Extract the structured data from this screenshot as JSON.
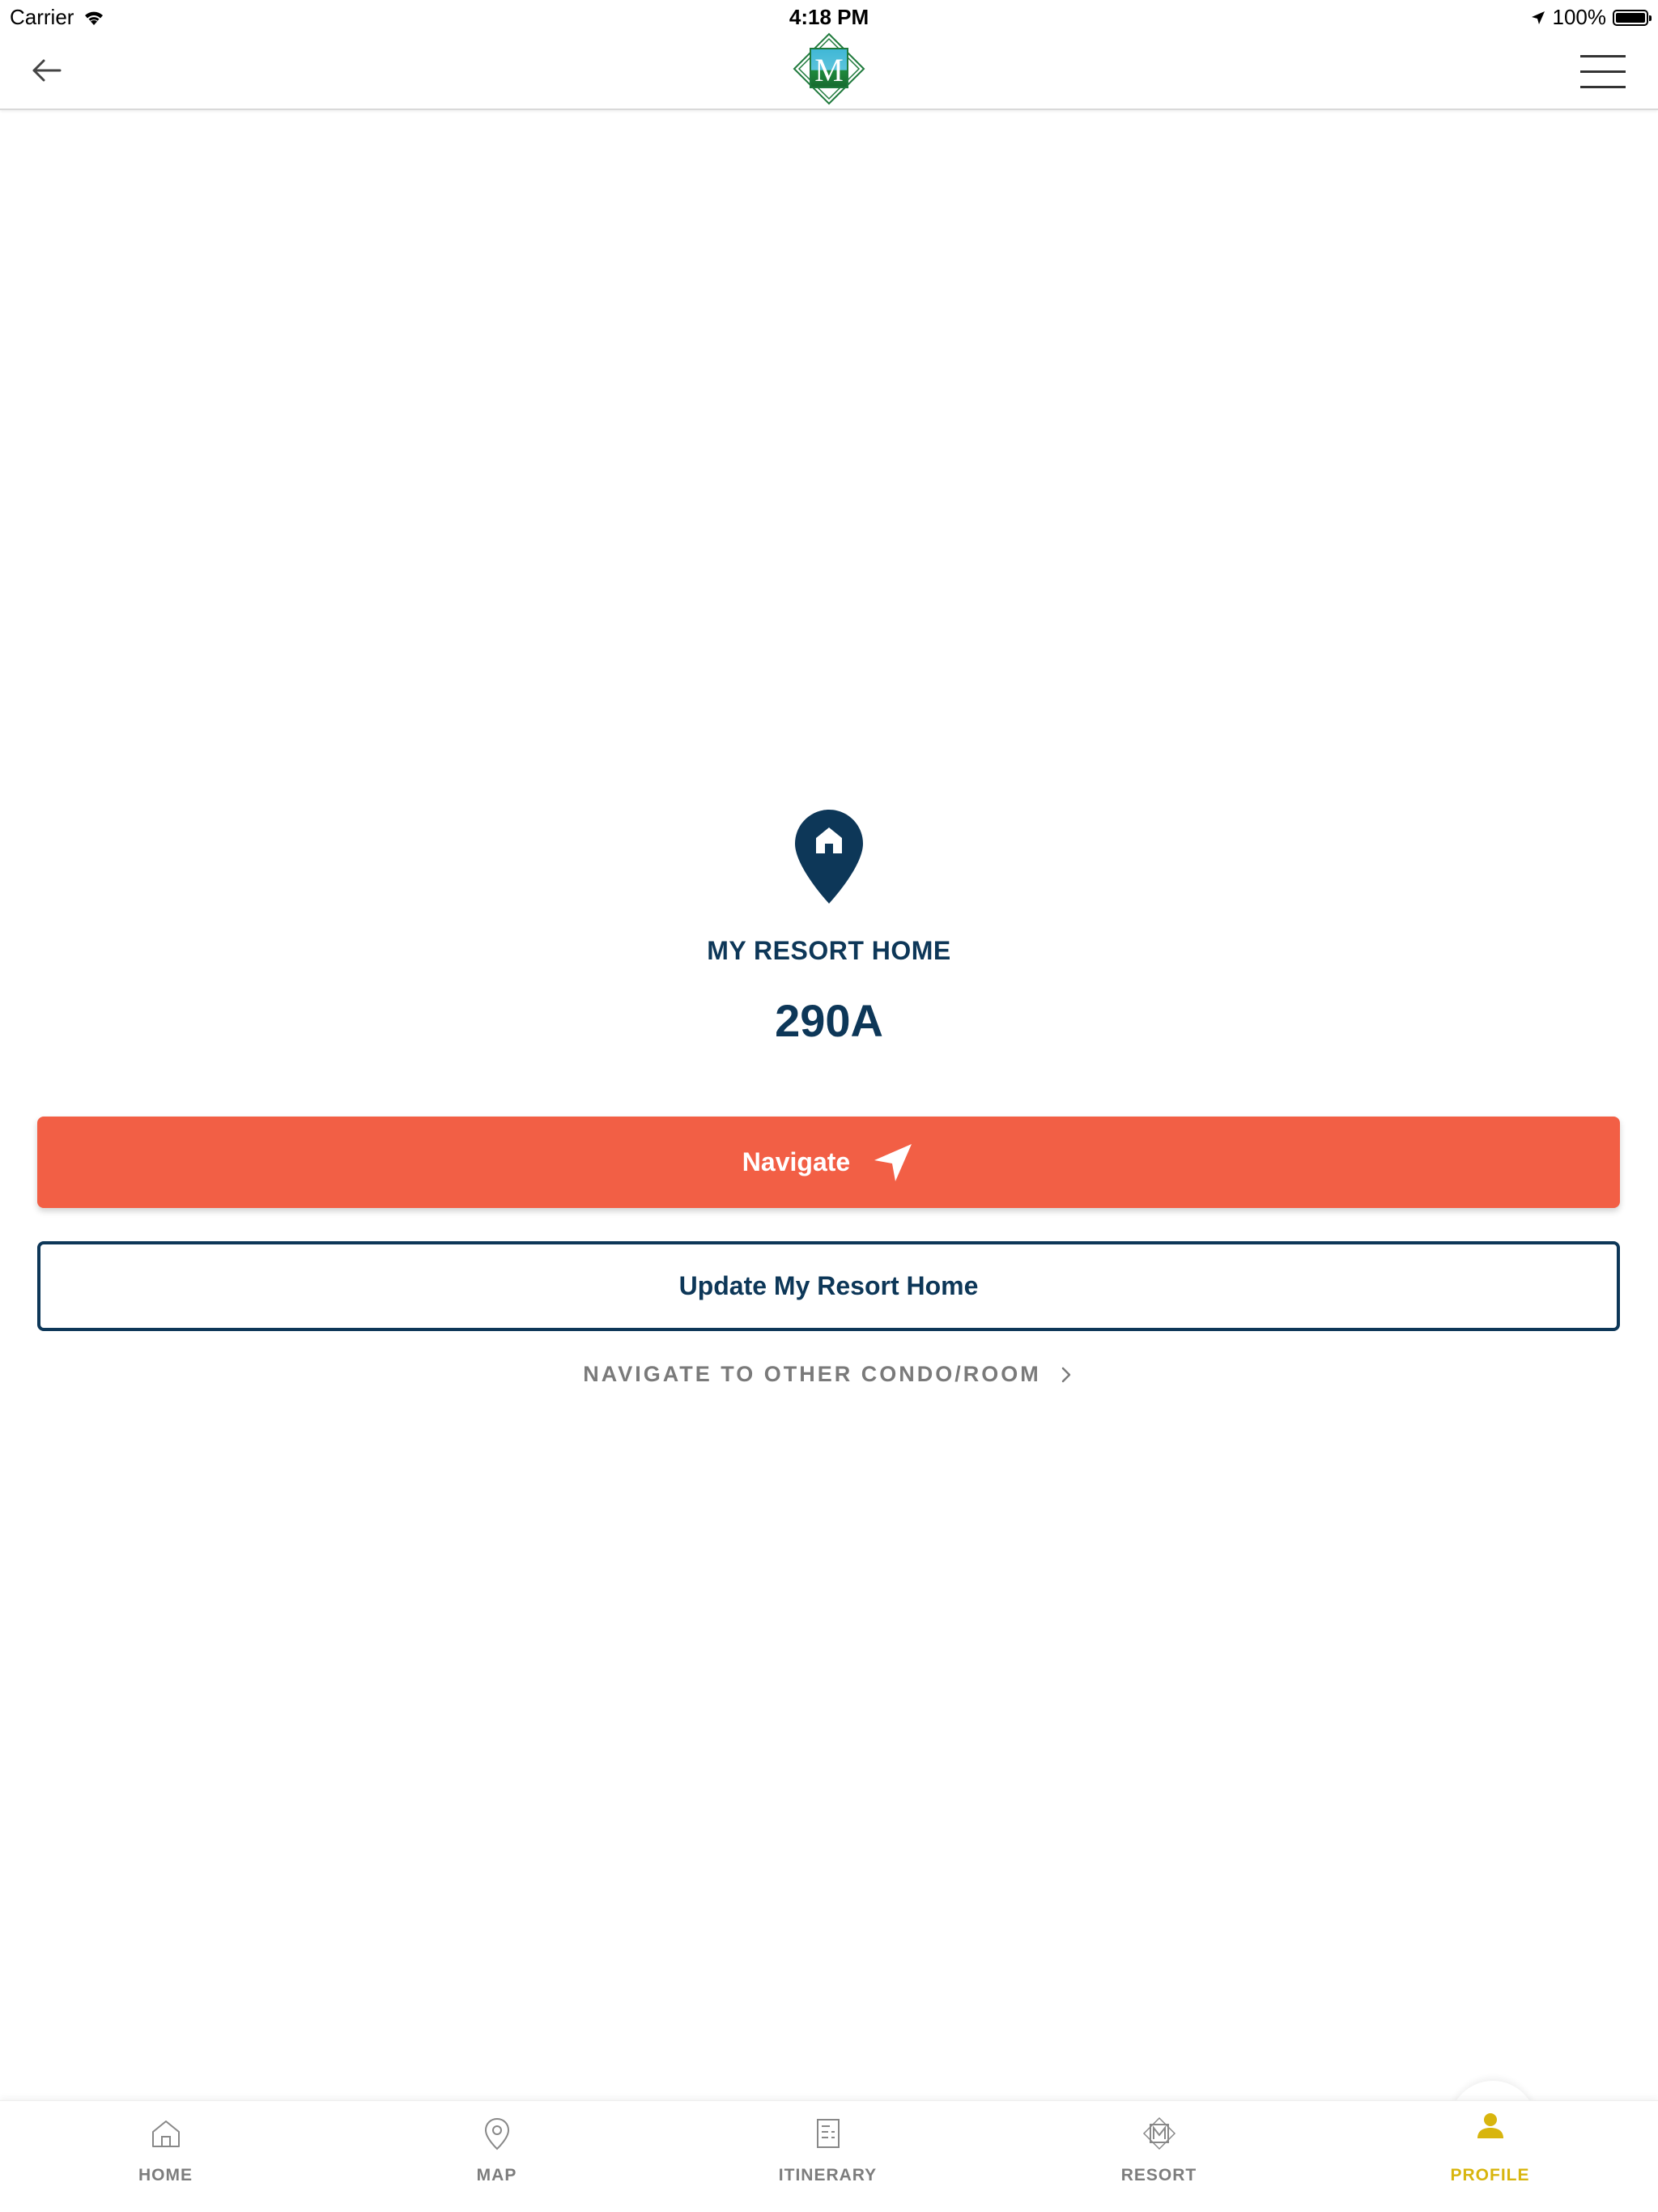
{
  "status_bar": {
    "carrier": "Carrier",
    "time": "4:18 PM",
    "battery": "100%"
  },
  "nav": {
    "logo_letter": "M"
  },
  "home": {
    "label": "MY RESORT HOME",
    "room": "290A"
  },
  "actions": {
    "navigate_label": "Navigate",
    "update_label": "Update My Resort Home",
    "other_link_label": "NAVIGATE TO OTHER CONDO/ROOM"
  },
  "tabs": [
    {
      "label": "HOME",
      "icon": "home-icon"
    },
    {
      "label": "MAP",
      "icon": "map-pin-icon"
    },
    {
      "label": "ITINERARY",
      "icon": "itinerary-icon"
    },
    {
      "label": "RESORT",
      "icon": "resort-logo-icon"
    },
    {
      "label": "PROFILE",
      "icon": "profile-icon",
      "active": true
    }
  ],
  "colors": {
    "navy": "#0d3758",
    "coral": "#f25f45",
    "active_tab": "#d8b50e",
    "inactive_tab": "#7d7d7d"
  }
}
